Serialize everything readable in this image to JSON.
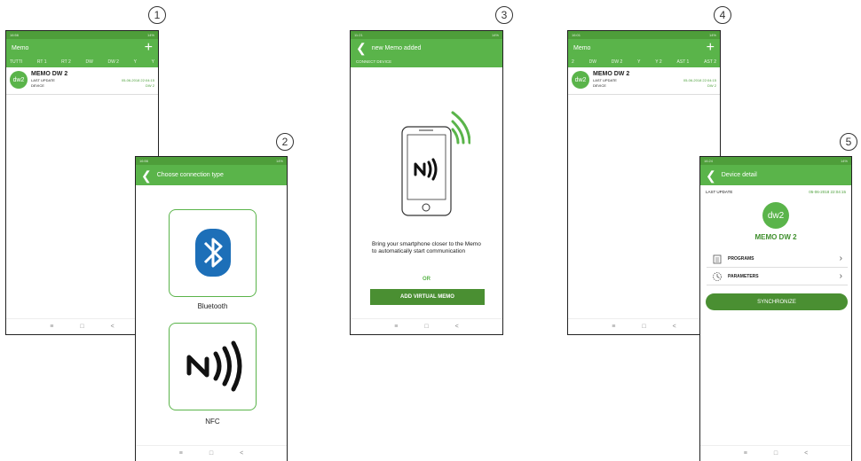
{
  "colors": {
    "accent": "#5ab44a",
    "accent_dark": "#4a8f32"
  },
  "badges": [
    "1",
    "2",
    "3",
    "4",
    "5"
  ],
  "statusbar": {
    "time1": "16:56",
    "time2": "16:56",
    "time3": "11:21",
    "time4": "16:01",
    "time5": "16:24",
    "battery": "14%"
  },
  "screen1": {
    "title": "Memo",
    "tabs": [
      "TUTTI",
      "RT 1",
      "RT 2",
      "DW",
      "DW 2",
      "Y",
      "Y"
    ],
    "item": {
      "avatar": "dw2",
      "name": "MEMO DW 2",
      "last_update_label": "LAST UPDATE",
      "last_update_value": "05-06-2018 22:04:15",
      "device_label": "DEVICE",
      "device_value": "DW 2"
    }
  },
  "screen2": {
    "title": "Choose connection type",
    "bluetooth_label": "Bluetooth",
    "nfc_label": "NFC"
  },
  "screen3": {
    "title": "new Memo added",
    "subtitle": "CONNECT DEVICE",
    "instruction": "Bring your smartphone closer to the Memo to automatically start communication",
    "or": "OR",
    "button": "ADD VIRTUAL MEMO"
  },
  "screen4": {
    "title": "Memo",
    "tabs": [
      "2",
      "DW",
      "DW 2",
      "Y",
      "Y 2",
      "AST 1",
      "AST 2"
    ],
    "item": {
      "avatar": "dw2",
      "name": "MEMO DW 2",
      "last_update_label": "LAST UPDATE",
      "last_update_value": "05-06-2018 22:04:15",
      "device_label": "DEVICE",
      "device_value": "DW 2"
    }
  },
  "screen5": {
    "title": "Device detail",
    "last_update_label": "LAST UPDATE",
    "last_update_value": "05-06-2018 22:04:15",
    "avatar": "dw2",
    "name": "MEMO DW 2",
    "programs": "PROGRAMS",
    "parameters": "PARAMETERS",
    "sync": "SYNCHRONIZE"
  },
  "nav": {
    "menu": "≡",
    "home": "□",
    "back": "<"
  }
}
